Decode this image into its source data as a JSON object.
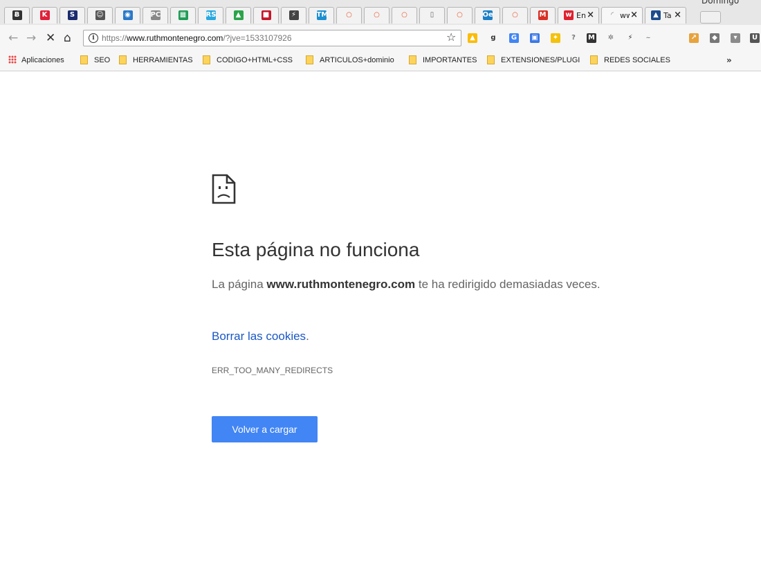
{
  "window": {
    "profile_name": "Domingo",
    "tabs": [
      {
        "icon": "b-icon",
        "color": "#333333",
        "glyph": "Ƀ",
        "title": ""
      },
      {
        "icon": "k-icon",
        "color": "#e0203a",
        "glyph": "K",
        "title": ""
      },
      {
        "icon": "s-icon",
        "color": "#1b2b6e",
        "glyph": "S",
        "title": ""
      },
      {
        "icon": "robot-icon",
        "color": "#555555",
        "glyph": "☺",
        "title": ""
      },
      {
        "icon": "shield-icon",
        "color": "#2a78c8",
        "glyph": "◉",
        "title": ""
      },
      {
        "icon": "pc-icon",
        "color": "#888888",
        "glyph": "PC",
        "title": ""
      },
      {
        "icon": "sheets-icon",
        "color": "#1e9b55",
        "glyph": "▦",
        "title": ""
      },
      {
        "icon": "rs-icon",
        "color": "#29a8e0",
        "glyph": "RS",
        "title": ""
      },
      {
        "icon": "lock-icon",
        "color": "#2ca34a",
        "glyph": "▲",
        "title": ""
      },
      {
        "icon": "red-block-icon",
        "color": "#c4162a",
        "glyph": "■",
        "title": ""
      },
      {
        "icon": "bolt-icon",
        "color": "#444444",
        "glyph": "⚡",
        "title": ""
      },
      {
        "icon": "tm-icon",
        "color": "#1b8fd1",
        "glyph": "TM",
        "title": ""
      },
      {
        "icon": "circle-icon",
        "color": "#e8542c",
        "glyph": "○",
        "title": ""
      },
      {
        "icon": "circle-icon",
        "color": "#e8542c",
        "glyph": "○",
        "title": ""
      },
      {
        "icon": "circle-icon",
        "color": "#e8542c",
        "glyph": "○",
        "title": ""
      },
      {
        "icon": "page-icon",
        "color": "#666666",
        "glyph": "▯",
        "title": ""
      },
      {
        "icon": "circle-icon",
        "color": "#e8542c",
        "glyph": "○",
        "title": ""
      },
      {
        "icon": "oe-icon",
        "color": "#1b7fc6",
        "glyph": "Oe",
        "title": ""
      },
      {
        "icon": "circle-icon",
        "color": "#e8542c",
        "glyph": "○",
        "title": ""
      },
      {
        "icon": "gmail-icon",
        "color": "#d93025",
        "glyph": "M",
        "title": ""
      },
      {
        "icon": "w-icon",
        "color": "#e0202f",
        "glyph": "w",
        "title": "En"
      },
      {
        "icon": "loading-icon",
        "color": "#777777",
        "glyph": "◜",
        "title": "ww"
      },
      {
        "icon": "mountain-icon",
        "color": "#1d4c8c",
        "glyph": "▲",
        "title": "Ta"
      }
    ],
    "url_scheme": "https://",
    "url_domain": "www.ruthmontenegro.com",
    "url_rest": "/?jve=1533107926",
    "bookmarks": [
      {
        "label": "Aplicaciones",
        "type": "apps"
      },
      {
        "label": "SEO",
        "type": "folder"
      },
      {
        "label": "HERRAMIENTAS",
        "type": "folder"
      },
      {
        "label": "CODIGO+HTML+CSS",
        "type": "folder"
      },
      {
        "label": "ARTICULOS+dominio",
        "type": "folder"
      },
      {
        "label": "IMPORTANTES",
        "type": "folder"
      },
      {
        "label": "EXTENSIONES/PLUGI",
        "type": "folder"
      },
      {
        "label": "REDES SOCIALES",
        "type": "folder"
      }
    ],
    "bookmarks_overflow": "»"
  },
  "error_page": {
    "heading": "Esta página no funciona",
    "desc_before": "La página ",
    "desc_domain": "www.ruthmontenegro.com",
    "desc_after": " te ha redirigido demasiadas veces.",
    "cookies_link": "Borrar las cookies",
    "cookies_period": ".",
    "error_code": "ERR_TOO_MANY_REDIRECTS",
    "reload_button": "Volver a cargar",
    "button_color": "#4285f4",
    "link_color": "#1a57c4"
  }
}
